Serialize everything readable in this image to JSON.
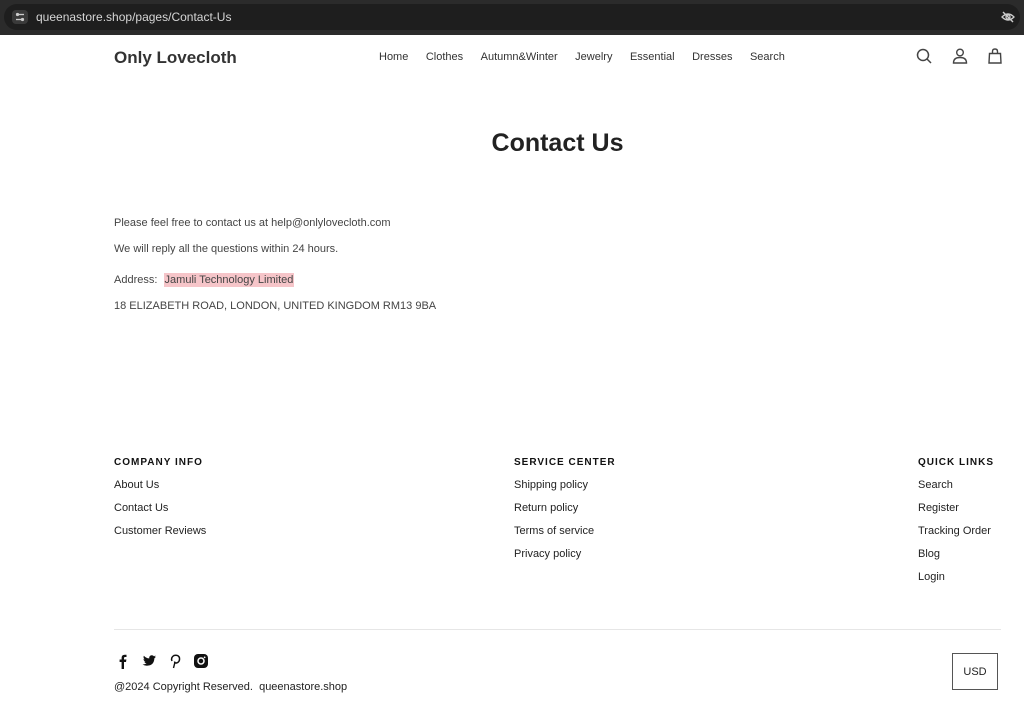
{
  "browser": {
    "url": "queenastore.shop/pages/Contact-Us"
  },
  "header": {
    "logo": "Only Lovecloth",
    "nav": [
      "Home",
      "Clothes",
      "Autumn&Winter",
      "Jewelry",
      "Essential",
      "Dresses",
      "Search"
    ],
    "icons": [
      "search-icon",
      "account-icon",
      "cart-icon"
    ]
  },
  "page": {
    "title": "Contact Us",
    "line1": "Please feel free to contact us at help@onlylovecloth.com",
    "line2": "We will reply all the questions within 24 hours.",
    "address_label": "Address:",
    "address_company": "Jamuli Technology Limited",
    "address_street": "18 ELIZABETH ROAD, LONDON, UNITED KINGDOM RM13 9BA"
  },
  "footer": {
    "company_info": {
      "heading": "COMPANY INFO",
      "links": [
        "About Us",
        "Contact Us",
        "Customer Reviews"
      ]
    },
    "service_center": {
      "heading": "SERVICE CENTER",
      "links": [
        "Shipping policy",
        "Return policy",
        "Terms of service",
        "Privacy policy"
      ]
    },
    "quick_links": {
      "heading": "QUICK LINKS",
      "links": [
        "Search",
        "Register",
        "Tracking Order",
        "Blog",
        "Login"
      ]
    },
    "social": [
      "facebook-icon",
      "twitter-icon",
      "pinterest-icon",
      "instagram-icon"
    ],
    "copyright": "@2024 Copyright Reserved.  queenastore.shop",
    "currency": "USD"
  },
  "colors": {
    "highlight": "#f6c5c9",
    "urlbar": "#2b2b2b"
  }
}
